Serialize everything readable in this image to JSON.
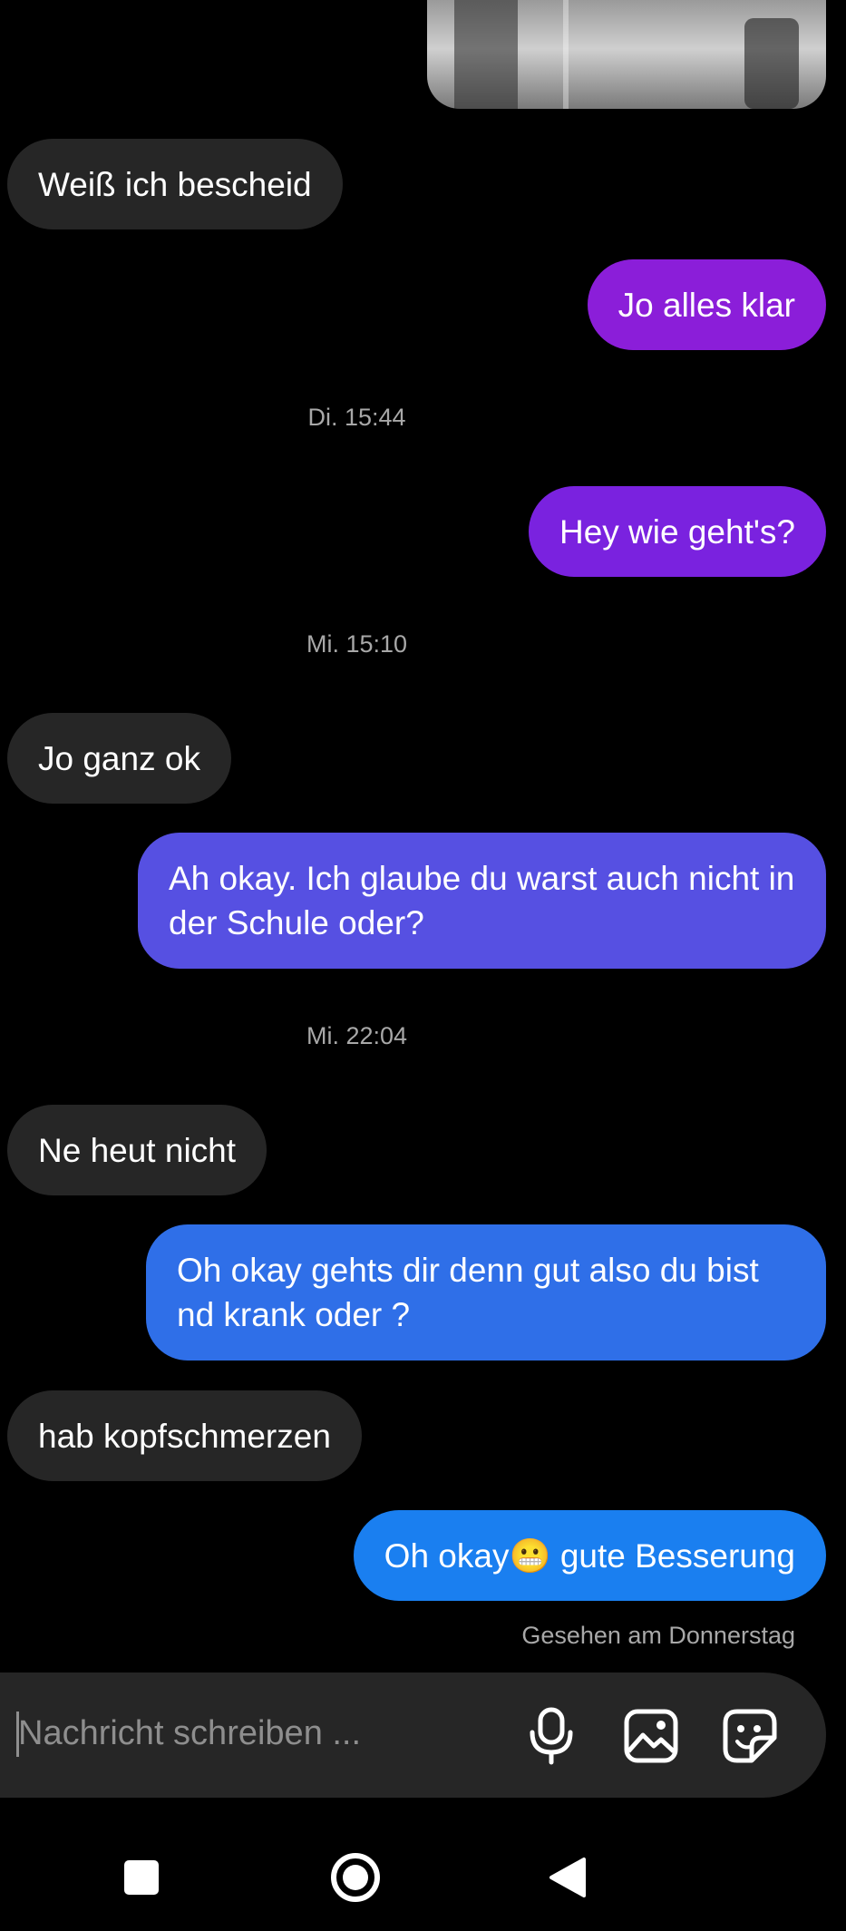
{
  "messages": [
    {
      "direction": "in",
      "text": "Weiß ich bescheid"
    },
    {
      "direction": "out",
      "text": "Jo alles klar",
      "color": "#8b1ed9"
    },
    {
      "timestamp": "Di. 15:44"
    },
    {
      "direction": "out",
      "text": "Hey wie geht's?",
      "color": "#7a22df"
    },
    {
      "timestamp": "Mi. 15:10"
    },
    {
      "direction": "in",
      "text": "Jo ganz ok"
    },
    {
      "direction": "out",
      "text": "Ah okay. Ich glaube du warst auch nicht in der Schule oder?",
      "color": "#5650e2"
    },
    {
      "timestamp": "Mi. 22:04"
    },
    {
      "direction": "in",
      "text": "Ne heut nicht"
    },
    {
      "direction": "out",
      "text": "Oh okay gehts dir denn gut also du bist nd krank oder ?",
      "color": "#2f6fe8"
    },
    {
      "direction": "in",
      "text": "hab kopfschmerzen"
    },
    {
      "direction": "out",
      "text": "Oh okay😬 gute Besserung",
      "color": "#1a7ff0"
    }
  ],
  "read_receipt": "Gesehen am Donnerstag",
  "composer": {
    "placeholder": "Nachricht schreiben ...",
    "icons": [
      "microphone-icon",
      "image-icon",
      "sticker-icon"
    ]
  },
  "navigation": {
    "icons": [
      "recents-square-icon",
      "home-circle-icon",
      "back-triangle-icon"
    ]
  },
  "colors": {
    "background": "#000000",
    "incoming_bubble": "#262626",
    "secondary_text": "#a8a8a8"
  }
}
